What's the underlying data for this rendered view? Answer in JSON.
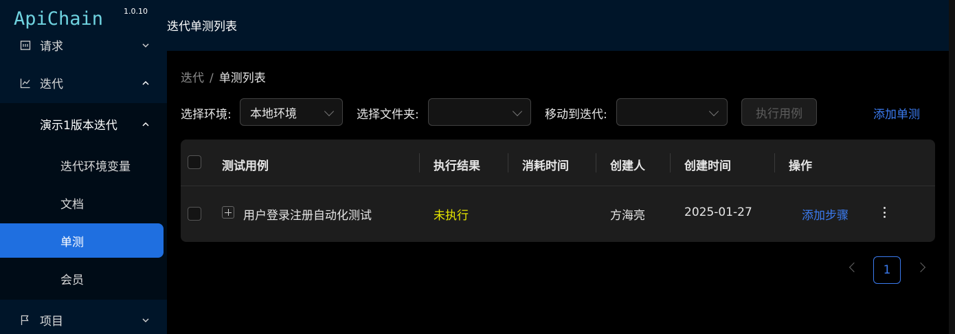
{
  "app": {
    "name": "ApiChain",
    "version": "1.0.10"
  },
  "sidebar": {
    "items": [
      {
        "label": "请求",
        "icon": "request-icon",
        "expanded": false
      },
      {
        "label": "迭代",
        "icon": "line-chart-icon",
        "expanded": true
      },
      {
        "label": "项目",
        "icon": "flag-icon",
        "expanded": false
      }
    ],
    "iteration_group": {
      "label": "演示1版本迭代",
      "expanded": true
    },
    "sub_items": [
      {
        "label": "迭代环境变量"
      },
      {
        "label": "文档"
      },
      {
        "label": "单测",
        "active": true
      },
      {
        "label": "会员"
      }
    ],
    "colors": {
      "bg": "#001529",
      "active": "#1f6fe0"
    }
  },
  "header": {
    "title": "迭代单测列表"
  },
  "breadcrumb": {
    "parent": "迭代",
    "separator": "/",
    "current": "单测列表"
  },
  "filters": {
    "env_label": "选择环境:",
    "env_value": "本地环境",
    "folder_label": "选择文件夹:",
    "folder_value": "",
    "move_label": "移动到迭代:",
    "move_value": "",
    "run_button": "执行用例",
    "add_button": "添加单测"
  },
  "table": {
    "headers": [
      "测试用例",
      "执行结果",
      "消耗时间",
      "创建人",
      "创建时间",
      "操作"
    ],
    "rows": [
      {
        "name": "用户登录注册自动化测试",
        "status": "未执行",
        "duration": "",
        "creator": "方海亮",
        "created": "2025-01-27",
        "action": "添加步骤"
      }
    ]
  },
  "pagination": {
    "current": "1"
  }
}
